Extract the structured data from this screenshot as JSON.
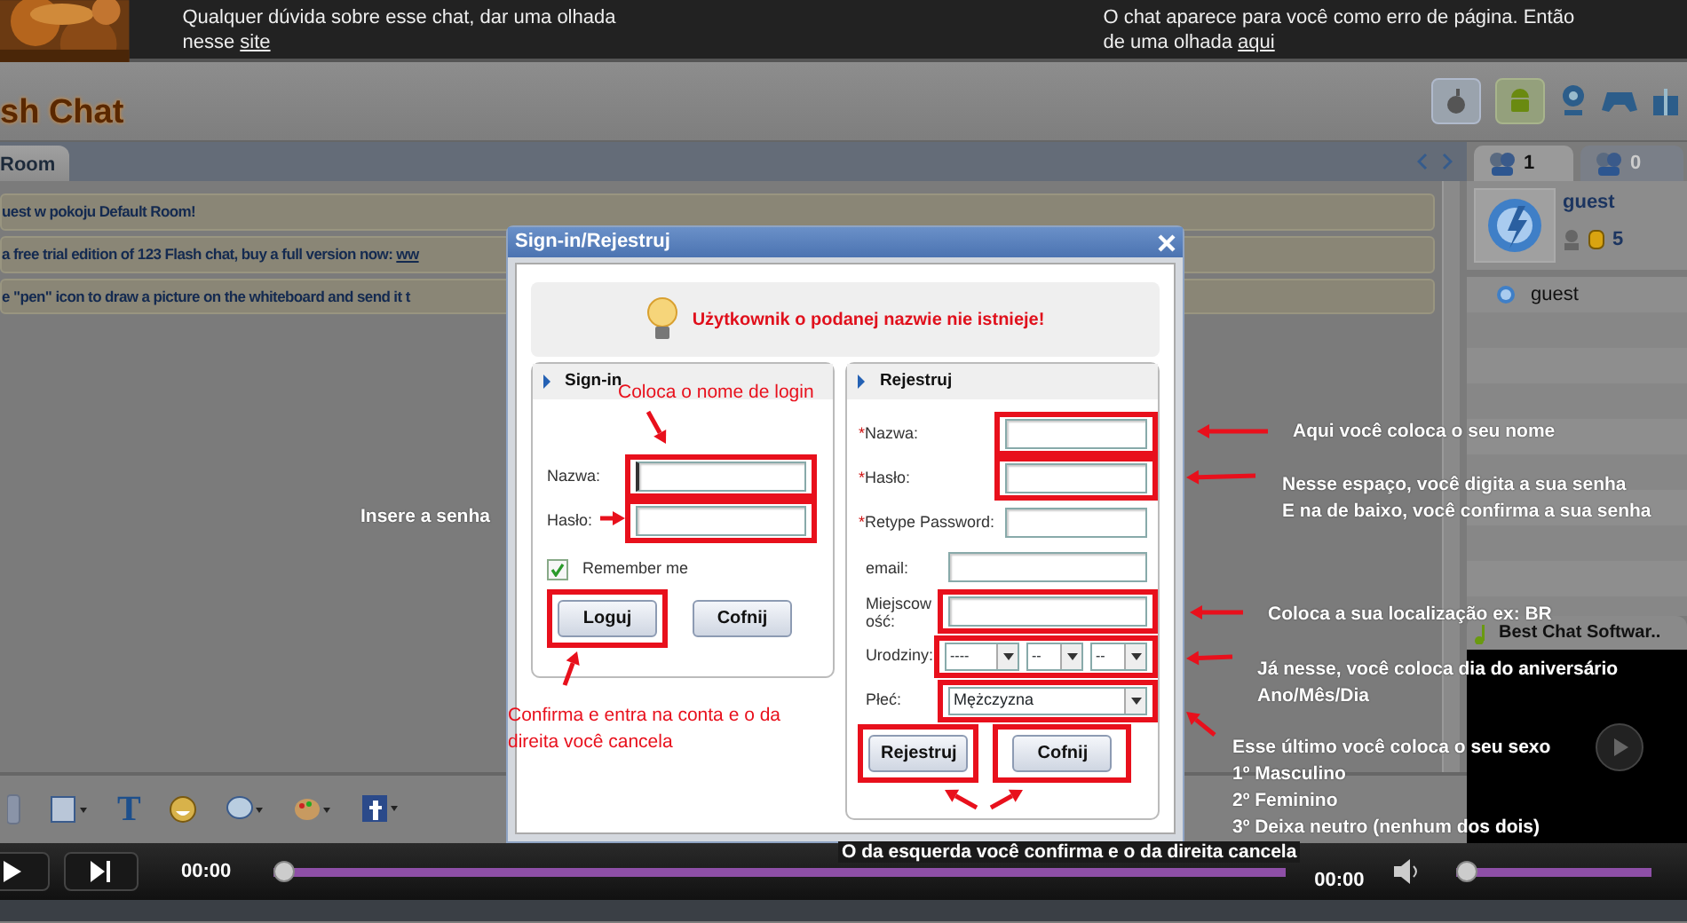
{
  "banner": {
    "left": {
      "lines": [
        "Qualquer dúvida sobre esse chat, dar uma olhada",
        "nesse "
      ],
      "link": "site"
    },
    "right": {
      "lines": [
        "O chat aparece para você como erro de página. Então",
        "de uma olhada "
      ],
      "link": "aqui"
    }
  },
  "header": {
    "logo": "sh Chat"
  },
  "room_tabs": [
    {
      "label": "Room",
      "selected": true
    }
  ],
  "messages": [
    {
      "text": "uest w pokoju Default Room!"
    },
    {
      "text": "a free trial edition of 123 Flash chat, buy a full version now: ",
      "link": "ww"
    },
    {
      "text": "e \"pen\" icon to draw a picture on the whiteboard and send it t"
    }
  ],
  "toolbar": {
    "text_button": "T"
  },
  "user_tabs": [
    {
      "count": "1",
      "selected": true
    },
    {
      "count": "0",
      "selected": false
    }
  ],
  "current_user": {
    "name": "guest",
    "points": "5"
  },
  "user_list": [
    {
      "name": "guest"
    }
  ],
  "media": {
    "title": "Best Chat Softwar.."
  },
  "player": {
    "time": "00:00",
    "duration": "00:00",
    "progress": {
      "level": 0
    },
    "volume": {
      "level": 0
    }
  },
  "dialog": {
    "title": "Sign-in/Rejestruj",
    "message": "Użytkownik o podanej nazwie nie istnieje!",
    "signin": {
      "title": "Sign-in",
      "fields": [
        {
          "label": "Nazwa:",
          "focused": true,
          "highlighted": true
        },
        {
          "label": "Hasło:",
          "focused": false,
          "highlighted": true
        }
      ],
      "remember": {
        "label": "Remember me",
        "checked": true
      },
      "buttons": [
        {
          "label": "Loguj",
          "highlighted": true
        },
        {
          "label": "Cofnij",
          "highlighted": false
        }
      ]
    },
    "register": {
      "title": "Rejestruj",
      "fields": [
        {
          "kind": "text",
          "mark": "*",
          "label": "Nazwa:",
          "highlighted": true
        },
        {
          "kind": "text",
          "mark": "*",
          "label": "Hasło:",
          "highlighted": true
        },
        {
          "kind": "text",
          "mark": "*",
          "label": "Retype Password:",
          "highlighted": false
        },
        {
          "kind": "text",
          "label": "email:",
          "highlighted": false
        },
        {
          "kind": "text",
          "label": "Miejscowość:",
          "highlighted": true
        },
        {
          "kind": "date",
          "label": "Urodziny:",
          "highlighted": true,
          "selects": [
            "----",
            "--",
            "--"
          ]
        },
        {
          "kind": "select",
          "label": "Płeć:",
          "highlighted": true,
          "value": "Mężczyzna"
        }
      ],
      "buttons": [
        {
          "label": "Rejestruj",
          "highlighted": true
        },
        {
          "label": "Cofnij",
          "highlighted": true
        }
      ]
    }
  },
  "annotations": [
    {
      "kind": "callout",
      "lines": [
        "Coloca o nome de login"
      ]
    },
    {
      "kind": "caption",
      "lines": [
        "Insere a senha"
      ]
    },
    {
      "kind": "callout",
      "lines": [
        "Confirma e entra na conta e o da",
        "direita você cancela"
      ]
    },
    {
      "kind": "caption",
      "lines": [
        "Aqui você coloca o seu nome"
      ]
    },
    {
      "kind": "caption",
      "lines": [
        "Nesse espaço, você digita a sua senha",
        "E na de baixo, você confirma a sua senha"
      ]
    },
    {
      "kind": "caption",
      "lines": [
        "Coloca a sua localização ex: BR"
      ]
    },
    {
      "kind": "caption",
      "lines": [
        "Já nesse, você coloca dia do aniversário",
        "Ano/Mês/Dia"
      ]
    },
    {
      "kind": "caption",
      "lines": [
        "Esse último você coloca o seu sexo",
        "1º Masculino",
        "2º Feminino",
        "3º Deixa neutro (nenhum dos dois)"
      ]
    },
    {
      "kind": "caption",
      "lines": [
        "O da esquerda você confirma e o da direita cancela"
      ]
    }
  ]
}
